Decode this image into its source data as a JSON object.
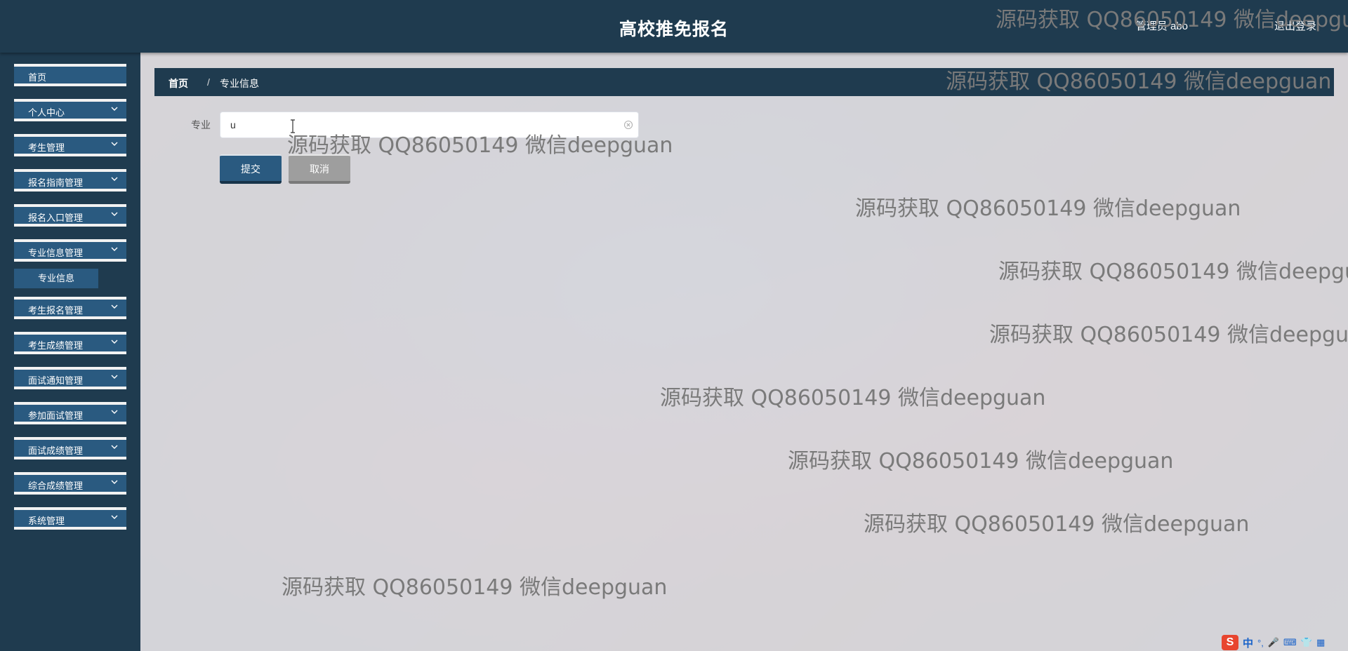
{
  "header": {
    "app_title": "高校推免报名",
    "user_label": "管理员 abo",
    "logout_label": "退出登录"
  },
  "sidebar": {
    "items": [
      {
        "label": "首页",
        "has_arrow": false
      },
      {
        "label": "个人中心",
        "has_arrow": true
      },
      {
        "label": "考生管理",
        "has_arrow": true
      },
      {
        "label": "报名指南管理",
        "has_arrow": true
      },
      {
        "label": "报名入口管理",
        "has_arrow": true
      },
      {
        "label": "专业信息管理",
        "has_arrow": true,
        "expanded": true
      },
      {
        "label": "考生报名管理",
        "has_arrow": true
      },
      {
        "label": "考生成绩管理",
        "has_arrow": true
      },
      {
        "label": "面试通知管理",
        "has_arrow": true
      },
      {
        "label": "参加面试管理",
        "has_arrow": true
      },
      {
        "label": "面试成绩管理",
        "has_arrow": true
      },
      {
        "label": "综合成绩管理",
        "has_arrow": true
      },
      {
        "label": "系统管理",
        "has_arrow": true
      }
    ],
    "submenu": {
      "label": "专业信息"
    }
  },
  "breadcrumb": {
    "home": "首页",
    "separator": "/",
    "current": "专业信息"
  },
  "form": {
    "field_label": "专业",
    "field_value": "u",
    "submit_label": "提交",
    "cancel_label": "取消"
  },
  "watermark_text": "源码获取 QQ86050149 微信deepguan",
  "ime": {
    "logo": "S",
    "mode": "中",
    "punct": "°,",
    "glyphs": [
      "🎤",
      "⌨",
      "👕",
      "▦"
    ]
  },
  "colors": {
    "header_bg": "#1f3b4f",
    "menu_item_bg": "#2a5a80",
    "submit_bg": "#2a5a80",
    "cancel_bg": "#9e9e9e"
  }
}
